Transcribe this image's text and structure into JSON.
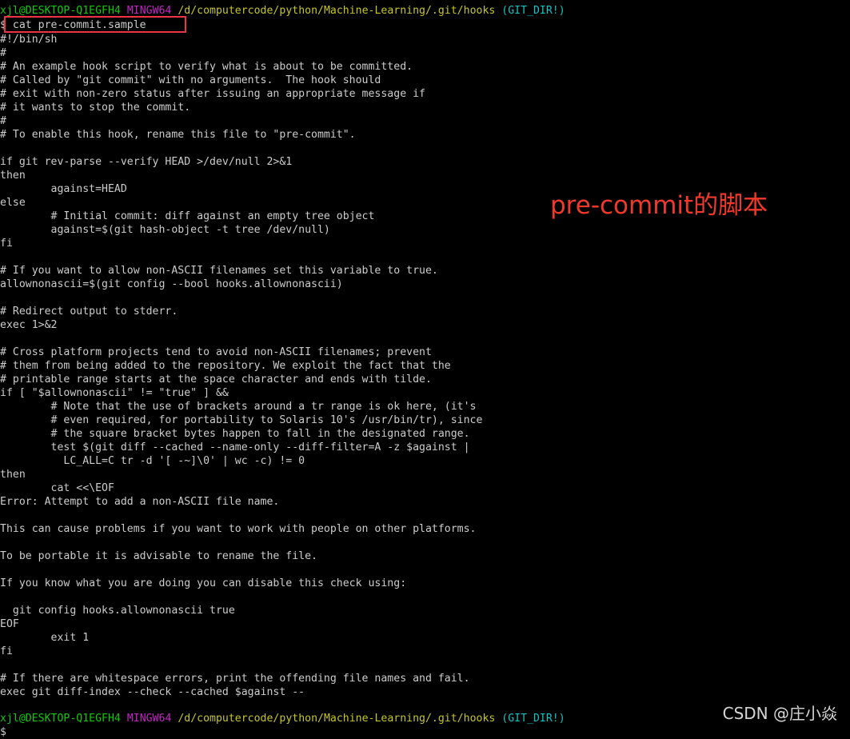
{
  "terminal": {
    "title": "MINGW64 git bash",
    "colors": {
      "background": "#000000",
      "foreground": "#cccccc",
      "user_green": "#16c60c",
      "mingw_magenta": "#c426c4",
      "path_yellow": "#c6c62a",
      "gitdir_cyan": "#16c2c2",
      "annotation_red": "#f0392b",
      "highlight_box": "#ee3344"
    },
    "prompt_top": {
      "user_host": "xjl@DESKTOP-Q1EGFH4",
      "shell": "MINGW64",
      "path": "/d/computercode/python/Machine-Learning/.git/hooks",
      "git_state": "(GIT_DIR!)"
    },
    "prompt_bottom": {
      "user_host": "xjl@DESKTOP-Q1EGFH4",
      "shell": "MINGW64",
      "path": "/d/computercode/python/Machine-Learning/.git/hooks",
      "git_state": "(GIT_DIR!)"
    },
    "command": {
      "symbol": "$",
      "text": " cat pre-commit.sample"
    },
    "output_lines": [
      "#!/bin/sh",
      "#",
      "# An example hook script to verify what is about to be committed.",
      "# Called by \"git commit\" with no arguments.  The hook should",
      "# exit with non-zero status after issuing an appropriate message if",
      "# it wants to stop the commit.",
      "#",
      "# To enable this hook, rename this file to \"pre-commit\".",
      "",
      "if git rev-parse --verify HEAD >/dev/null 2>&1",
      "then",
      "        against=HEAD",
      "else",
      "        # Initial commit: diff against an empty tree object",
      "        against=$(git hash-object -t tree /dev/null)",
      "fi",
      "",
      "# If you want to allow non-ASCII filenames set this variable to true.",
      "allownonascii=$(git config --bool hooks.allownonascii)",
      "",
      "# Redirect output to stderr.",
      "exec 1>&2",
      "",
      "# Cross platform projects tend to avoid non-ASCII filenames; prevent",
      "# them from being added to the repository. We exploit the fact that the",
      "# printable range starts at the space character and ends with tilde.",
      "if [ \"$allownonascii\" != \"true\" ] &&",
      "        # Note that the use of brackets around a tr range is ok here, (it's",
      "        # even required, for portability to Solaris 10's /usr/bin/tr), since",
      "        # the square bracket bytes happen to fall in the designated range.",
      "        test $(git diff --cached --name-only --diff-filter=A -z $against |",
      "          LC_ALL=C tr -d '[ -~]\\0' | wc -c) != 0",
      "then",
      "        cat <<\\EOF",
      "Error: Attempt to add a non-ASCII file name.",
      "",
      "This can cause problems if you want to work with people on other platforms.",
      "",
      "To be portable it is advisable to rename the file.",
      "",
      "If you know what you are doing you can disable this check using:",
      "",
      "  git config hooks.allownonascii true",
      "EOF",
      "        exit 1",
      "fi",
      "",
      "# If there are whitespace errors, print the offending file names and fail.",
      "exec git diff-index --check --cached $against --"
    ]
  },
  "annotation": {
    "text": "pre-commit的脚本"
  },
  "watermark": {
    "text": "CSDN @庄小焱"
  }
}
